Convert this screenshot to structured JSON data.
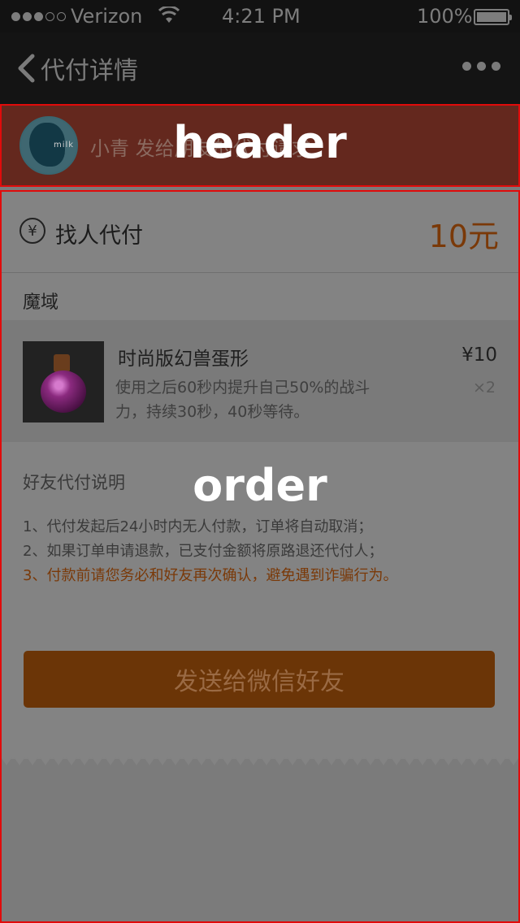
{
  "status_bar": {
    "carrier": "Verizon",
    "time": "4:21 PM",
    "battery": "100%"
  },
  "nav": {
    "back_label": "代付详情"
  },
  "header": {
    "sender_text": "小青  发给朋友的代付请求",
    "avatar_text": "milk",
    "annotation_label": "header"
  },
  "order": {
    "annotation_label": "order",
    "pay_label": "找人代付",
    "pay_amount": "10元",
    "shop_name": "魔域",
    "item": {
      "name": "时尚版幻兽蛋形",
      "description": "使用之后60秒内提升自己50%的战斗力，持续30秒，40秒等待。",
      "price": "¥10",
      "quantity": "×2"
    },
    "note_title": "好友代付说明",
    "notes": [
      "1、代付发起后24小时内无人付款，订单将自动取消；",
      "2、如果订单申请退款，已支付金额将原路退还代付人；",
      "3、付款前请您务必和好友再次确认，避免遇到诈骗行为。"
    ],
    "send_button": "发送给微信好友"
  },
  "colors": {
    "accent": "#7a3908",
    "annotation": "#e10b0b"
  }
}
